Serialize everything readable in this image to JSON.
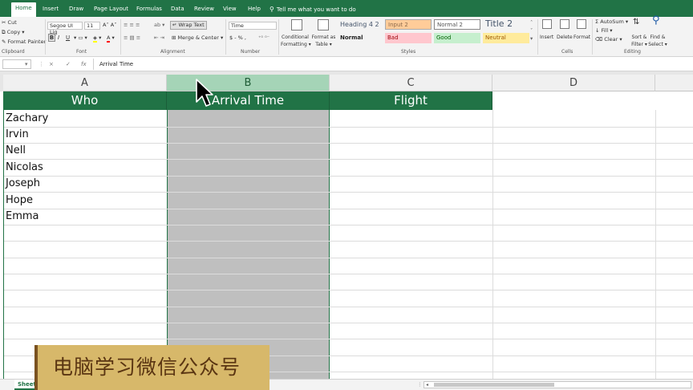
{
  "tabs": [
    "Home",
    "Insert",
    "Draw",
    "Page Layout",
    "Formulas",
    "Data",
    "Review",
    "View",
    "Help"
  ],
  "tell_me": "Tell me what you want to do",
  "clipboard": {
    "cut": "Cut",
    "copy": "Copy",
    "format_painter": "Format Painter",
    "label": "Clipboard"
  },
  "font": {
    "name": "Segoe UI Lig",
    "size": "11",
    "label": "Font",
    "bold": "B",
    "italic": "I",
    "underline": "U"
  },
  "alignment": {
    "wrap": "Wrap Text",
    "merge": "Merge & Center",
    "label": "Alignment"
  },
  "number": {
    "format": "Time",
    "symbols": "$ - % ,",
    "label": "Number"
  },
  "styles": {
    "cond_1": "Conditional",
    "cond_2": "Formatting",
    "fat_1": "Format as",
    "fat_2": "Table",
    "heading4": "Heading 4 2",
    "input2": "Input 2",
    "normal2": "Normal 2",
    "title2": "Title 2",
    "normal": "Normal",
    "bad": "Bad",
    "good": "Good",
    "neutral": "Neutral",
    "label": "Styles"
  },
  "cells": {
    "insert": "Insert",
    "delete": "Delete",
    "format": "Format",
    "label": "Cells"
  },
  "editing": {
    "autosum": "AutoSum",
    "fill": "Fill",
    "clear": "Clear",
    "sort_1": "Sort &",
    "sort_2": "Filter",
    "find_1": "Find &",
    "find_2": "Select",
    "label": "Editing"
  },
  "formula_bar": {
    "cancel": "×",
    "enter": "✓",
    "fx": "fx",
    "content": "Arrival Time"
  },
  "columns": [
    "A",
    "B",
    "C",
    "D"
  ],
  "headers": [
    "Who",
    "Arrival Time",
    "Flight"
  ],
  "rows": [
    "Zachary",
    "Irvin",
    "Nell",
    "Nicolas",
    "Joseph",
    "Hope",
    "Emma"
  ],
  "sheet_tab": "Sheet",
  "watermark": "电脑学习微信公众号",
  "colors": {
    "accent": "#217346",
    "selected_col": "#bfbfbf",
    "watermark_bg": "#d7b86a"
  }
}
